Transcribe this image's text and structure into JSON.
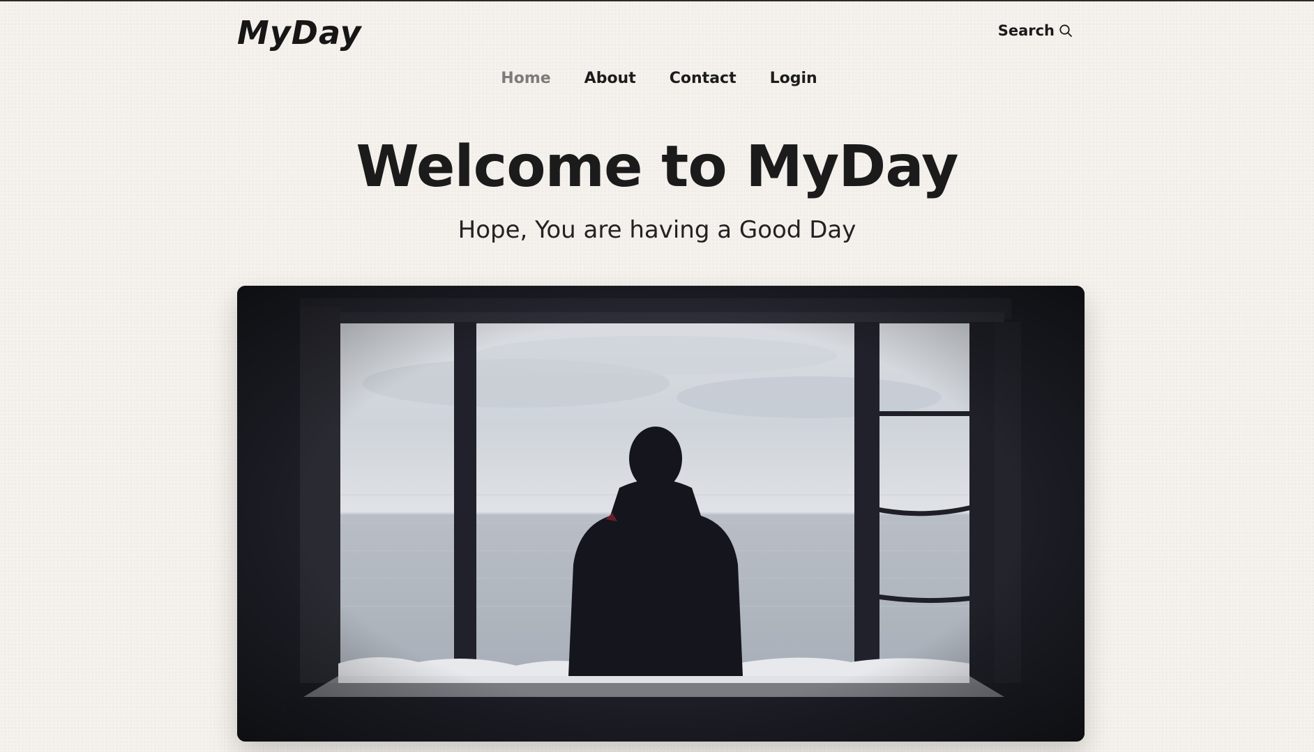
{
  "header": {
    "logo": "MyDay",
    "search_label": "Search",
    "search_icon": "search-icon"
  },
  "nav": {
    "items": [
      {
        "label": "Home",
        "active": true
      },
      {
        "label": "About",
        "active": false
      },
      {
        "label": "Contact",
        "active": false
      },
      {
        "label": "Login",
        "active": false
      }
    ]
  },
  "hero": {
    "title": "Welcome to MyDay",
    "subtitle": "Hope, You are having a Good Day",
    "image": "person-looking-at-sea-through-window"
  },
  "colors": {
    "background": "#f5f1ec",
    "text": "#1c1c1c",
    "nav_active": "#7b7b7b",
    "image_frame": "#1c1d25"
  }
}
